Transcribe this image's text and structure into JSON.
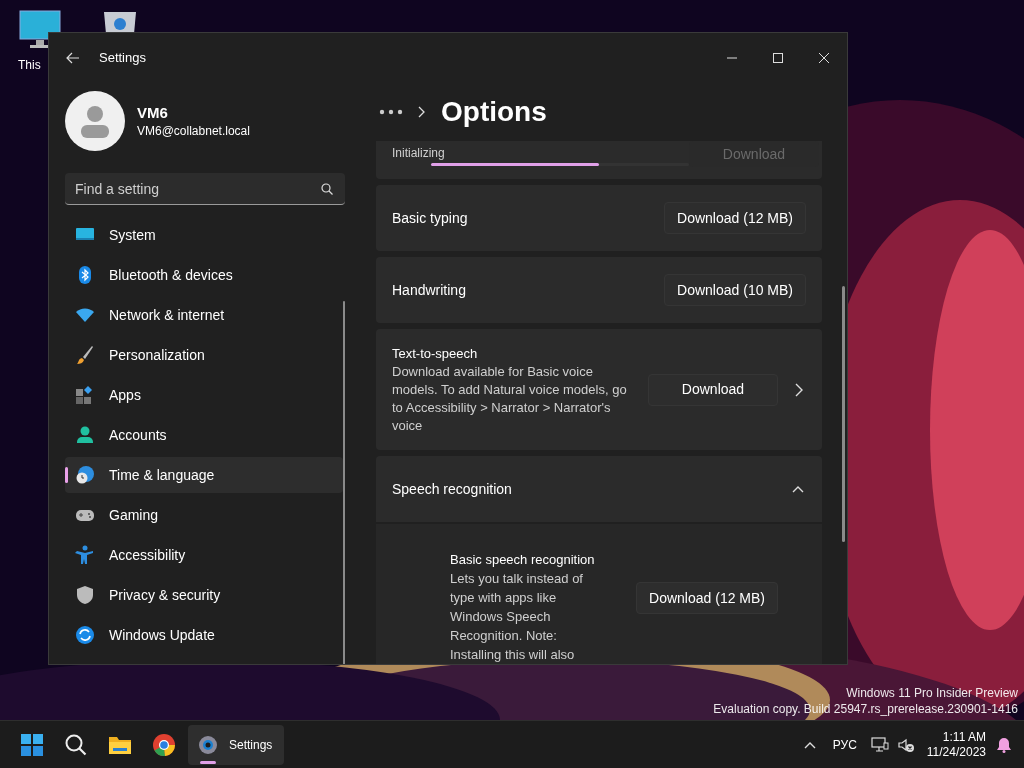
{
  "desktop_icons": [
    {
      "kind": "monitor",
      "label": "This"
    },
    {
      "kind": "bin"
    }
  ],
  "window": {
    "title": "Settings"
  },
  "account": {
    "name": "VM6",
    "email": "VM6@collabnet.local"
  },
  "search": {
    "placeholder": "Find a setting"
  },
  "nav": [
    {
      "label": "System",
      "selected": false
    },
    {
      "label": "Bluetooth & devices",
      "selected": false
    },
    {
      "label": "Network & internet",
      "selected": false
    },
    {
      "label": "Personalization",
      "selected": false
    },
    {
      "label": "Apps",
      "selected": false
    },
    {
      "label": "Accounts",
      "selected": false
    },
    {
      "label": "Time & language",
      "selected": true
    },
    {
      "label": "Gaming",
      "selected": false
    },
    {
      "label": "Accessibility",
      "selected": false
    },
    {
      "label": "Privacy & security",
      "selected": false
    },
    {
      "label": "Windows Update",
      "selected": false
    }
  ],
  "page_title": "Options",
  "cards": [
    {
      "kind": "progress",
      "status": "Initializing",
      "level": 0.65,
      "button": {
        "label": "Download",
        "disabled": true
      }
    },
    {
      "kind": "simple",
      "title": "Basic typing",
      "button": {
        "label": "Download (12 MB)",
        "disabled": false
      }
    },
    {
      "kind": "simple",
      "title": "Handwriting",
      "button": {
        "label": "Download (10 MB)",
        "disabled": false
      }
    },
    {
      "kind": "link",
      "title": "Text-to-speech",
      "description": "Download available for Basic voice models. To add Natural voice models, go to Accessibility > Narrator > Narrator's voice",
      "button": {
        "label": "Download",
        "disabled": false
      }
    },
    {
      "kind": "expander",
      "title": "Speech recognition",
      "expanded": true,
      "children": [
        {
          "title": "Basic speech recognition",
          "description": "Lets you talk instead of type with apps like Windows Speech Recognition. Note: Installing this will also",
          "button": {
            "label": "Download (12 MB)",
            "disabled": false
          }
        }
      ]
    }
  ],
  "watermark": [
    "Windows 11 Pro Insider Preview",
    "Evaluation copy. Build 25947.rs_prerelease.230901-1416"
  ],
  "taskbar": {
    "items": [
      {
        "kind": "start"
      },
      {
        "kind": "search"
      },
      {
        "kind": "folder"
      },
      {
        "kind": "browser"
      },
      {
        "kind": "app",
        "label": "Settings",
        "active": true
      }
    ],
    "language": "РУС",
    "time": "1:11 AM",
    "date": "11/24/2023"
  }
}
